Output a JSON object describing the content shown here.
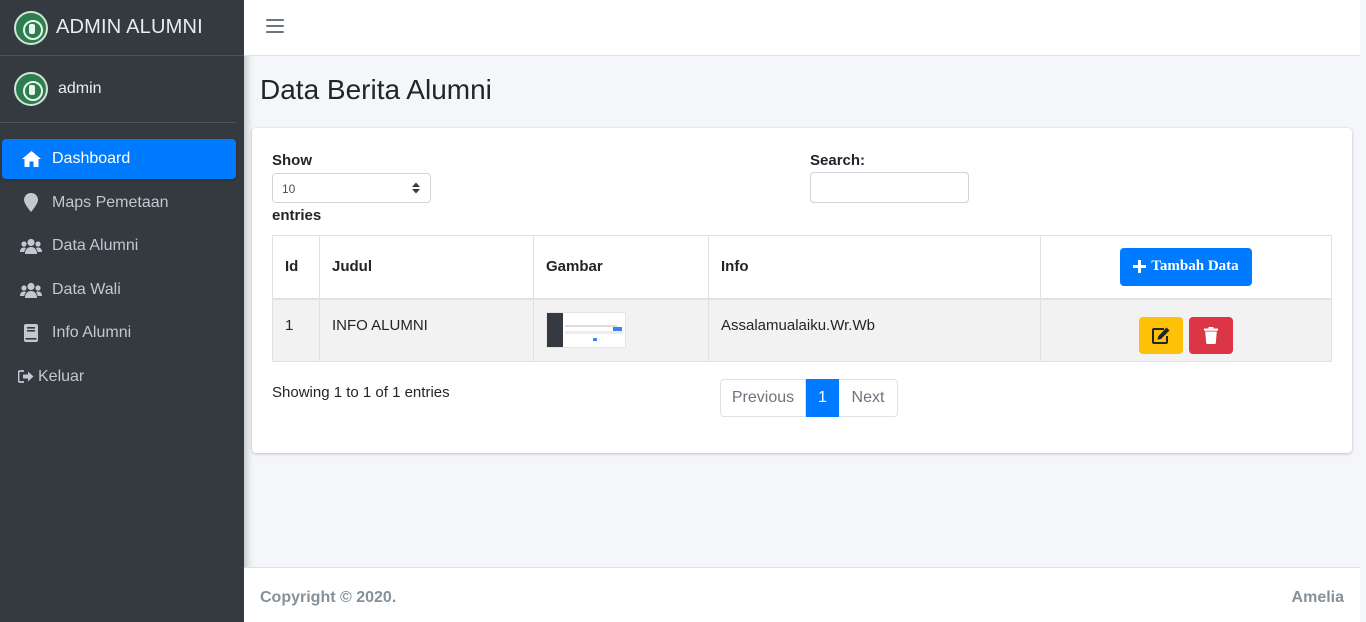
{
  "brand": {
    "title": "ADMIN ALUMNI",
    "logo_icon": "university-emblem-icon"
  },
  "user": {
    "name": "admin"
  },
  "sidebar": {
    "items": [
      {
        "label": "Dashboard",
        "icon": "home-icon",
        "active": true
      },
      {
        "label": "Maps Pemetaan",
        "icon": "map-marker-icon"
      },
      {
        "label": "Data Alumni",
        "icon": "users-icon"
      },
      {
        "label": "Data Wali",
        "icon": "users-icon"
      },
      {
        "label": "Info Alumni",
        "icon": "book-icon"
      },
      {
        "label": "Keluar",
        "icon": "sign-out-icon"
      }
    ]
  },
  "page": {
    "title": "Data Berita Alumni"
  },
  "table_controls": {
    "show_label": "Show",
    "entries_label": "entries",
    "length_value": "10",
    "search_label": "Search:",
    "search_value": ""
  },
  "table": {
    "columns": [
      "Id",
      "Judul",
      "Gambar",
      "Info"
    ],
    "add_button_label": "Tambah Data",
    "rows": [
      {
        "id": "1",
        "judul": "INFO ALUMNI",
        "info": "Assalamualaiku.Wr.Wb"
      }
    ]
  },
  "pagination": {
    "info": "Showing 1 to 1 of 1 entries",
    "previous": "Previous",
    "current": "1",
    "next": "Next"
  },
  "footer": {
    "copyright": "Copyright © 2020.",
    "author": "Amelia"
  },
  "colors": {
    "primary": "#007bff",
    "sidebar_bg": "#343a40",
    "warning": "#ffc107",
    "danger": "#dc3545"
  }
}
